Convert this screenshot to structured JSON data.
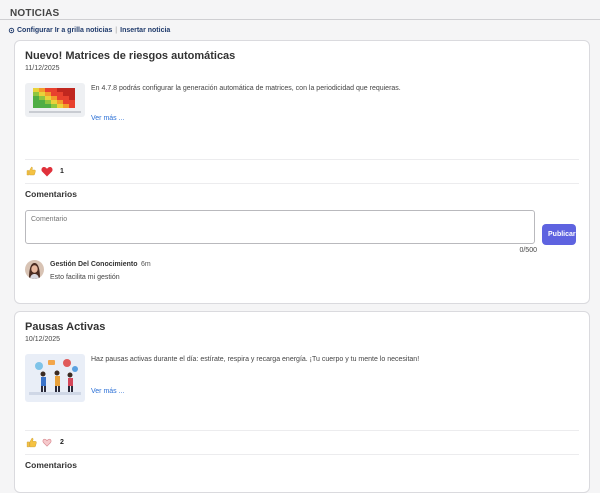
{
  "header": {
    "title": "NOTICIAS"
  },
  "toolbar": {
    "configure_label": "Configurar Ir a grilla noticias",
    "separator": "|",
    "insert_label": "Insertar noticia"
  },
  "posts": [
    {
      "title": "Nuevo! Matrices de riesgos automáticas",
      "date": "11/12/2025",
      "text": "En 4.7.8 podrás configurar la generación automática de matrices, con la periodicidad que requieras.",
      "more": "Ver más ...",
      "reaction_count": "1",
      "comments_title": "Comentarios",
      "comment_placeholder": "Comentario",
      "char_counter": "0/500",
      "publish_label": "Publicar",
      "comments": [
        {
          "author": "Gestión Del Conocimiento",
          "time": "6m",
          "text": "Esto facilita mi gestión"
        }
      ]
    },
    {
      "title": "Pausas Activas",
      "date": "10/12/2025",
      "text": "Haz pausas activas durante el día: estírate, respira y recarga energía. ¡Tu cuerpo y tu mente lo necesitan!",
      "more": "Ver más ...",
      "reaction_count": "2",
      "comments_title": "Comentarios"
    }
  ],
  "colors": {
    "accent": "#5e63e0",
    "link": "#2a6fd6",
    "heart": "#e0313b"
  }
}
